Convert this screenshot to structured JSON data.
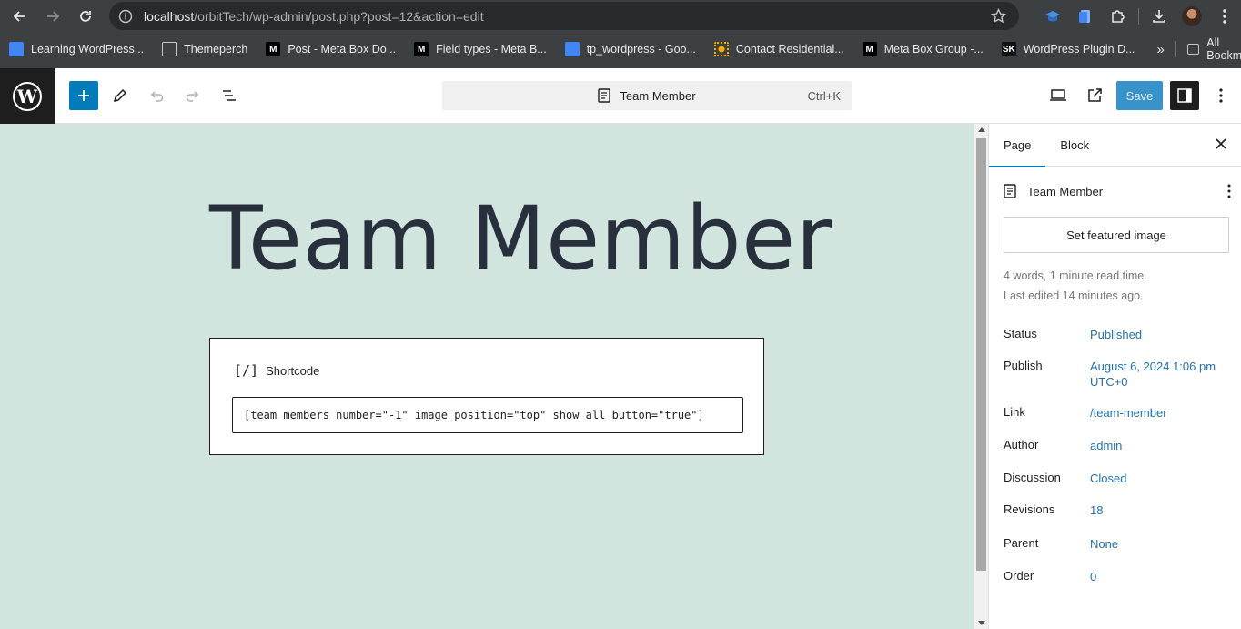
{
  "browser": {
    "url_host": "localhost",
    "url_path": "/orbitTech/wp-admin/post.php?post=12&action=edit",
    "bookmarks": [
      {
        "label": "Learning WordPress...",
        "icon": "google-doc-icon"
      },
      {
        "label": "Themeperch",
        "icon": "folder-icon"
      },
      {
        "label": "Post - Meta Box Do...",
        "icon": "medium-m-icon"
      },
      {
        "label": "Field types - Meta B...",
        "icon": "medium-m-icon"
      },
      {
        "label": "tp_wordpress - Goo...",
        "icon": "google-doc-icon"
      },
      {
        "label": "Contact Residential...",
        "icon": "sun-icon"
      },
      {
        "label": "Meta Box Group -...",
        "icon": "medium-m-icon"
      },
      {
        "label": "WordPress Plugin D...",
        "icon": "sk-icon"
      }
    ],
    "more_label": "»",
    "all_bookmarks_label": "All Bookmarks"
  },
  "editor": {
    "command_bar_title": "Team Member",
    "command_bar_shortcut": "Ctrl+K",
    "save_label": "Save"
  },
  "canvas": {
    "post_title": "Team Member",
    "shortcode_block_label": "Shortcode",
    "shortcode_icon": "[/]",
    "shortcode_value": "[team_members number=\"-1\" image_position=\"top\" show_all_button=\"true\"]"
  },
  "sidebar": {
    "tabs": [
      "Page",
      "Block"
    ],
    "doc_title": "Team Member",
    "featured_image_label": "Set featured image",
    "word_count": "4 words, 1 minute read time.",
    "last_edited": "Last edited 14 minutes ago.",
    "properties": [
      {
        "key": "Status",
        "value": "Published"
      },
      {
        "key": "Publish",
        "value": "August 6, 2024 1:06 pm UTC+0"
      },
      {
        "key": "Link",
        "value": "/team-member"
      },
      {
        "key": "Author",
        "value": "admin"
      },
      {
        "key": "Discussion",
        "value": "Closed"
      },
      {
        "key": "Revisions",
        "value": "18"
      },
      {
        "key": "Parent",
        "value": "None"
      },
      {
        "key": "Order",
        "value": "0"
      }
    ]
  },
  "colors": {
    "canvas_bg": "#d1e4dd",
    "accent": "#007cba",
    "link": "#2271b1"
  }
}
